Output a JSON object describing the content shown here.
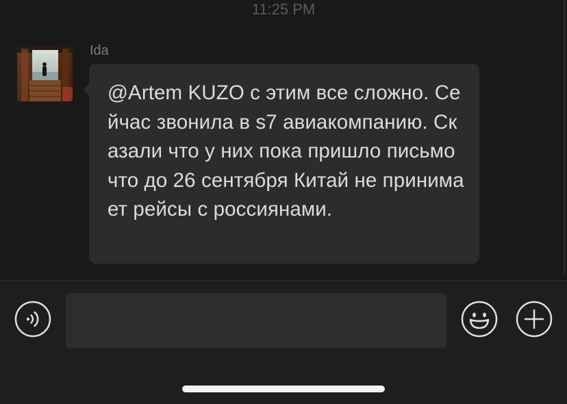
{
  "chat": {
    "timestamp": "11:25 PM",
    "messages": [
      {
        "sender": "Ida",
        "avatar": "avatar-photo-icon",
        "text": "@Artem KUZO с этим все сложно. Сейчас звонила в s7 авиакомпанию. Сказали что у них пока пришло письмо что до 26 сентября Китай не принимает рейсы с россиянами."
      }
    ]
  },
  "input_bar": {
    "voice_icon": "voice-icon",
    "input_value": "",
    "input_placeholder": "",
    "emoji_icon": "emoji-icon",
    "add_icon": "plus-icon"
  },
  "colors": {
    "background": "#191919",
    "bubble": "#2c2c2c",
    "bubble_text": "#dcdcdc",
    "input_bar": "#1e1e1e",
    "input_field": "#2d2d2d",
    "icon": "#e0e0e0"
  }
}
